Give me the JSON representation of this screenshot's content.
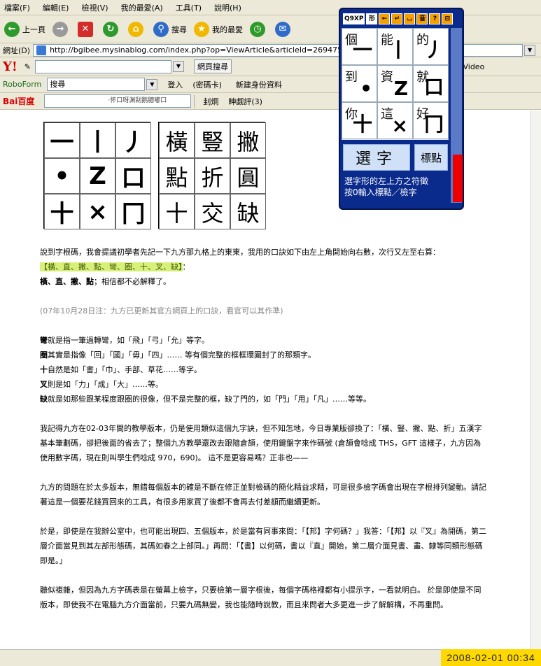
{
  "menu": [
    "檔案(F)",
    "編輯(E)",
    "檢視(V)",
    "我的最愛(A)",
    "工具(T)",
    "說明(H)"
  ],
  "toolbar": {
    "back": "上一頁",
    "search": "搜尋",
    "favorites": "我的最愛"
  },
  "address": {
    "label": "網址(D)",
    "url": "http://bgibee.mysinablog.com/index.php?op=ViewArticle&articleId=269475"
  },
  "yahoo": {
    "logo": "Y!",
    "search_btn": "網頁搜尋",
    "upload": "上載 Video"
  },
  "roboform": {
    "name": "RoboForm",
    "search": "搜尋",
    "login": "登入",
    "passcards": "(密碼卡)",
    "new_identity": "新建身份資料"
  },
  "baidu": {
    "logo": "Bai百度",
    "url_hint": "·怀口呀渊刮鹅臆嘟口",
    "item1": "刲炯",
    "item2": "眒觑評(3)"
  },
  "grid_strokes": [
    "一",
    "丨",
    "丿",
    "•",
    "Z",
    "口",
    "十",
    "×",
    "冂"
  ],
  "grid_chars": [
    "橫",
    "豎",
    "撇",
    "點",
    "折",
    "圓",
    "十",
    "交",
    "缺"
  ],
  "article": {
    "p1": "說到字根碼，我會提議初學者先記一下九方那九格上的東東，我用的口訣如下由左上角開始向右數，次行又左至右算：",
    "p1_hl": "【橫、直、撇、點、彎、圈、十、叉、缺】",
    "p1_tail": "：",
    "p1_b": "橫、直、撇、點",
    "p1_b_tail": "；相信都不必解釋了。",
    "p2": "(07年10月28日注：九方已更新其官方網頁上的口訣，看官可以其作準)",
    "l1_b": "彎",
    "l1": "就是指一筆過轉彎，如「飛」「弓」「允」等字。",
    "l2_b": "圈",
    "l2": "其實是指像「回」「國」「毋」「四」…… 等有個完整的框框環圍封了的那類字。",
    "l3_b": "十",
    "l3": "自然是如「書」「巾」、手部、草花……等字。",
    "l4_b": "叉",
    "l4": "則是如「力」「成」「大」……等。",
    "l5_b": "缺",
    "l5": "就是如那些跟某程度跟圈的很像，但不是完整的框，缺了門的，如「門」「用」「凡」……等等。",
    "p3": "我記得九方在02-03年間的教學版本，仍是使用類似這個九字訣，但不知怎地，今日專業版卻換了：「橫、豎、撇、點、折」五漢字基本筆劃碼，卻把後面的省去了；整個九方教學還改去跟隨倉頡，使用鍵盤字來作碼號 (倉頡會唸成 THS，GFT 這樣子，九方因為使用數字碼，現在則叫學生們唸成 970，690)。 這不是更容易嗎？正非也——",
    "p4": "九方的問題在於太多版本，無錯每個版本的確是不斷在修正並對檢碼的簡化精益求精，可是很多檢字碼會出現在字根排列變動。請記著這是一個要花錢買回來的工具，有很多用家買了後都不會再去付差額而繼續更新。",
    "p5": "於是，即使是在我辦公室中，也可能出現四、五個版本，於是當有同事來問：「【邦】字何碼？」我答：「【邦】以『叉』為開碼，第二層介面當見到其左部形態碼，其碼如春之上部同。」再問：「【書】以何碼，書以『直』開始，第二層介面見書、畫、隸等同類形態碼即是。」",
    "p6": "聽似複雜，但因為九方字碼表是在螢幕上檢字，只要檢第一層字根後，每個字碼格裡都有小提示字，一看就明白。 於是即使是不同版本，即使我不在電腦九方介面當前，只要九碼無變，我也能隨時說教，而且來問者大多更進一步了解解構，不再重問。"
  },
  "ime": {
    "buttons": [
      "Q9XP",
      "形",
      "←",
      "↵",
      "⌴",
      "音",
      "?",
      "⊟"
    ],
    "cells": [
      {
        "ch": "個",
        "sk": "一"
      },
      {
        "ch": "能",
        "sk": "丨"
      },
      {
        "ch": "的",
        "sk": "丿"
      },
      {
        "ch": "到",
        "sk": "•"
      },
      {
        "ch": "資",
        "sk": "Z"
      },
      {
        "ch": "就",
        "sk": "口"
      },
      {
        "ch": "你",
        "sk": "十"
      },
      {
        "ch": "這",
        "sk": "×"
      },
      {
        "ch": "好",
        "sk": "冂"
      }
    ],
    "select_btn": "選字",
    "punct_btn": "標點",
    "hint1": "選字形的左上方之符徵",
    "hint2": "按0輸入標點／檢字"
  },
  "clock": "2008-02-01  00:34",
  "colors": {
    "highlight": "#d8f07a",
    "ime_bg": "#0a2a8c",
    "clock_bg": "#ffd800"
  }
}
